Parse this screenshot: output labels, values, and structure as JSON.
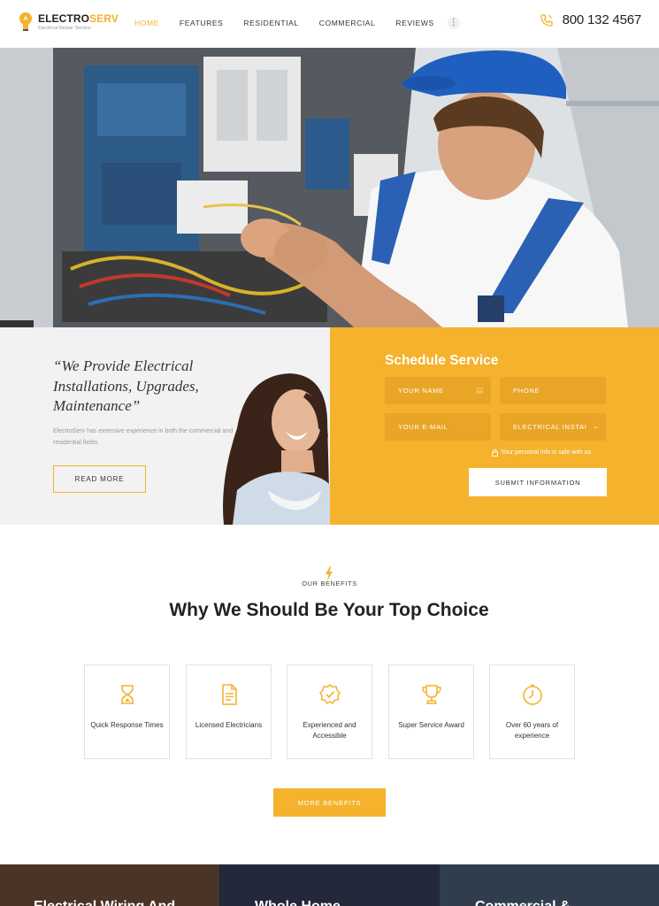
{
  "header": {
    "brand_part1": "ELECTRO",
    "brand_part2": "SERV",
    "tagline": "Electrical Repair Service",
    "nav": [
      "HOME",
      "FEATURES",
      "RESIDENTIAL",
      "COMMERCIAL",
      "REVIEWS"
    ],
    "more_symbol": "⋮",
    "phone": "800 132 4567"
  },
  "promo": {
    "quote": "“We Provide Electrical Installations, Upgrades, Maintenance”",
    "text": "ElectroServ has extensive experience in both the commercial and residential fields.",
    "button": "READ MORE"
  },
  "schedule": {
    "title": "Schedule Service",
    "name_placeholder": "YOUR NAME",
    "phone_placeholder": "PHONE",
    "email_placeholder": "YOUR E-MAIL",
    "service_selected": "ELECTRICAL INSTAI",
    "secure_note": "Your personal info is safe with us.",
    "submit": "SUBMIT INFORMATION"
  },
  "benefits": {
    "eyebrow": "OUR BENEFITS",
    "title": "Why We Should Be Your Top Choice",
    "items": [
      {
        "label": "Quick Response Times",
        "icon": "hourglass-icon"
      },
      {
        "label": "Licensed Electricians",
        "icon": "document-icon"
      },
      {
        "label": "Experienced and Accessible",
        "icon": "badge-check-icon"
      },
      {
        "label": "Super Service Award",
        "icon": "trophy-icon"
      },
      {
        "label": "Over 60 years of experience",
        "icon": "clock-icon"
      }
    ],
    "button": "MORE BENEFITS"
  },
  "bottom": {
    "titles": [
      "Electrical Wiring And",
      "Whole Home",
      "Commercial &"
    ]
  },
  "colors": {
    "accent": "#f4b22d",
    "accent_dark": "#e9a526",
    "text": "#222222"
  }
}
